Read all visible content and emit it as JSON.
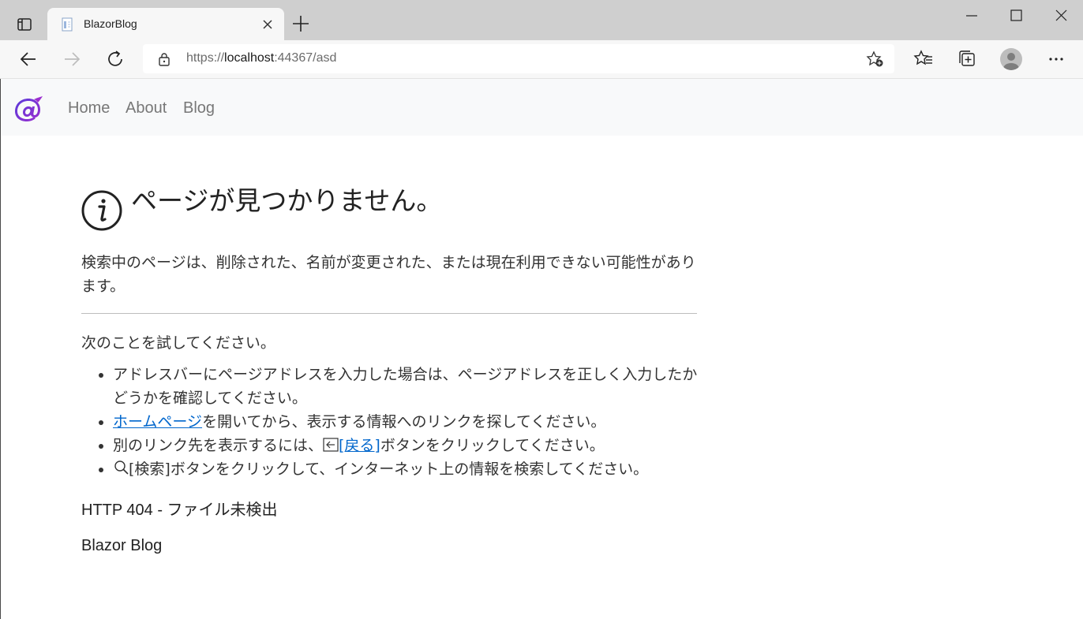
{
  "browser": {
    "tab_title": "BlazorBlog",
    "url_scheme": "https://",
    "url_host": "localhost",
    "url_rest": ":44367/asd"
  },
  "navbar": {
    "links": [
      "Home",
      "About",
      "Blog"
    ]
  },
  "error_page": {
    "heading": "ページが見つかりません。",
    "description": "検索中のページは、削除された、名前が変更された、または現在利用できない可能性があります。",
    "try_heading": "次のことを試してください。",
    "tip1": "アドレスバーにページアドレスを入力した場合は、ページアドレスを正しく入力したかどうかを確認してください。",
    "tip2_link": "ホームページ",
    "tip2_text": "を開いてから、表示する情報へのリンクを探してください。",
    "tip3_prefix": "別のリンク先を表示するには、",
    "tip3_link": "[戻る]",
    "tip3_suffix": "ボタンをクリックしてください。",
    "tip4_text": "[検索]ボタンをクリックして、インターネット上の情報を検索してください。",
    "status": "HTTP 404 - ファイル未検出",
    "footer": "Blazor Blog"
  },
  "colors": {
    "link": "#0066cc",
    "blazor_brand": "#7b2fd6"
  }
}
